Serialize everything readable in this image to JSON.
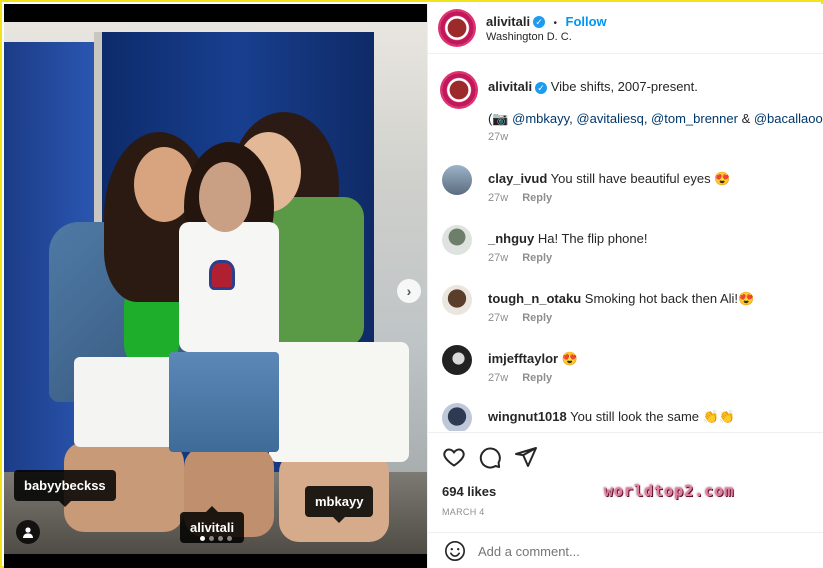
{
  "post": {
    "tags": [
      "babyybeckss",
      "alivitali",
      "mbkayy"
    ],
    "carousel_dots": 4,
    "carousel_active": 0
  },
  "header": {
    "username": "alivitali",
    "separator": "•",
    "follow_label": "Follow",
    "location": "Washington D. C."
  },
  "caption": {
    "username": "alivitali",
    "text": "Vibe shifts, 2007-present.",
    "mentions_prefix": "(📷 ",
    "mentions": [
      "@mbkayy",
      "@avitaliesq",
      "@tom_brenner"
    ],
    "mentions_sep": ", ",
    "mentions_amp": " & ",
    "last_mention": "@bacallaooo",
    "mentions_suffix": ")",
    "time": "27w"
  },
  "comments": [
    {
      "username": "clay_ivud",
      "text": "You still have beautiful eyes 😍",
      "time": "27w",
      "reply": "Reply",
      "avatar_color": "#6f7b88"
    },
    {
      "username": "_nhguy",
      "text": "Ha! The flip phone!",
      "time": "27w",
      "reply": "Reply",
      "avatar_color": "#9fa9a3"
    },
    {
      "username": "tough_n_otaku",
      "text": "Smoking hot back then Ali!😍",
      "time": "27w",
      "reply": "Reply",
      "avatar_color": "#7a6a5a"
    },
    {
      "username": "imjefftaylor",
      "text": "😍",
      "time": "27w",
      "reply": "Reply",
      "avatar_color": "#3a3a3a"
    },
    {
      "username": "wingnut1018",
      "text": "You still look the same 👏👏",
      "time": "",
      "reply": "",
      "avatar_color": "#4a5b74"
    }
  ],
  "actions": {
    "likes": "694 likes",
    "date": "MARCH 4"
  },
  "add_comment": {
    "placeholder": "Add a comment..."
  },
  "watermark": "worldtop2.com",
  "colors": {
    "accent": "#0095f6",
    "border": "#f2e21a",
    "verified": "#1d9bf0"
  }
}
